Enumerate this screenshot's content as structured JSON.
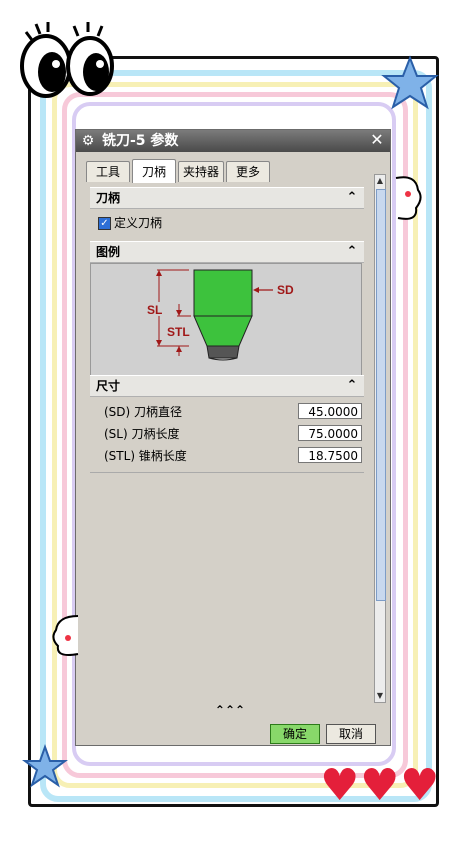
{
  "window": {
    "title": "铣刀-5 参数",
    "close_glyph": "✕",
    "settings_glyph": "⚙"
  },
  "tabs": [
    {
      "label": "工具"
    },
    {
      "label": "刀柄"
    },
    {
      "label": "夹持器"
    },
    {
      "label": "更多"
    }
  ],
  "active_tab": "刀柄",
  "sections": {
    "holder": {
      "title": "刀柄",
      "checkbox_label": "定义刀柄",
      "checked": true
    },
    "legend": {
      "title": "图例",
      "labels": {
        "sd": "SD",
        "sl": "SL",
        "stl": "STL"
      }
    },
    "dimensions": {
      "title": "尺寸",
      "rows": [
        {
          "label": "(SD) 刀柄直径",
          "value": "45.0000"
        },
        {
          "label": "(SL) 刀柄长度",
          "value": "75.0000"
        },
        {
          "label": "(STL) 锥柄长度",
          "value": "18.7500"
        }
      ]
    }
  },
  "chevron_glyph": "⌃",
  "expander_glyph": "⌃⌃⌃",
  "buttons": {
    "ok": "确定",
    "cancel": "取消"
  },
  "colors": {
    "shank_green": "#3dc23d",
    "dim_red": "#a01818",
    "ok_button": "#88d86a"
  }
}
